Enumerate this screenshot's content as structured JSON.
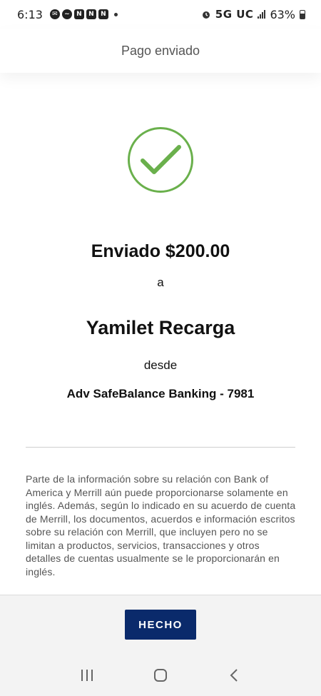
{
  "status_bar": {
    "time": "6:13",
    "network": "5G UC",
    "battery": "63%",
    "icons": [
      "chat-icon",
      "messenger-icon",
      "n-app-icon",
      "n-app-icon",
      "n-app-icon",
      "alarm-icon",
      "signal-icon",
      "battery-icon"
    ]
  },
  "header": {
    "title": "Pago enviado"
  },
  "confirmation": {
    "icon": "check-circle-icon",
    "check_color": "#6ab04c",
    "amount_text": "Enviado $200.00",
    "to_word": "a",
    "recipient": "Yamilet Recarga",
    "from_word": "desde",
    "account": "Adv SafeBalance Banking - 7981"
  },
  "disclaimer": "Parte de la información sobre su relación con Bank of America y Merrill aún puede proporcionarse solamente en inglés. Además, según lo indicado en su acuerdo de cuenta de Merrill, los documentos, acuerdos e información escritos sobre su relación con Merrill, que incluyen pero no se limitan a productos, servicios, transacciones y otros detalles de cuentas usualmente se le proporcionarán en inglés.",
  "footer": {
    "done_label": "HECHO",
    "button_color": "#0a2a6b"
  },
  "nav_bar": {
    "icons": [
      "recent-apps-icon",
      "home-icon",
      "back-icon"
    ]
  }
}
